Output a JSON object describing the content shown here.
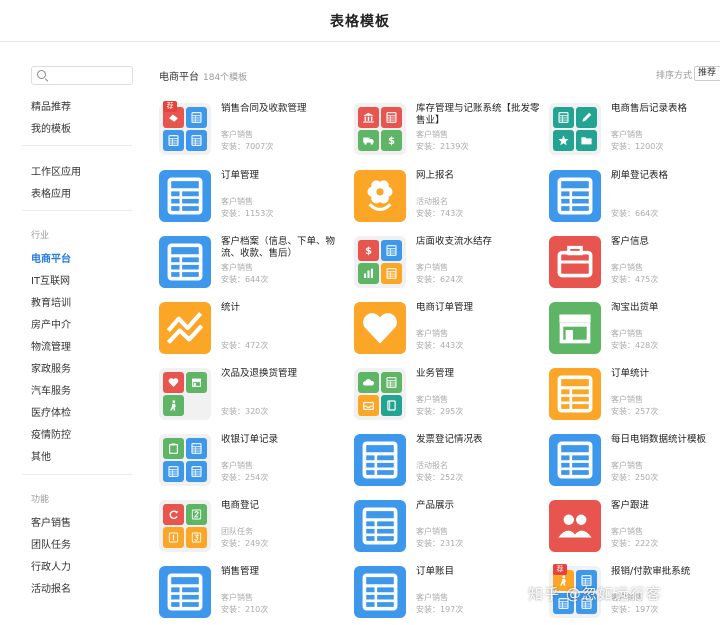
{
  "header": {
    "title": "表格模板"
  },
  "sidebar": {
    "search_placeholder": "",
    "top": [
      "精品推荐",
      "我的模板"
    ],
    "apps": [
      "工作区应用",
      "表格应用"
    ],
    "industry_heading": "行业",
    "industries": [
      "电商平台",
      "IT互联网",
      "教育培训",
      "房产中介",
      "物流管理",
      "家政服务",
      "汽车服务",
      "医疗体检",
      "疫情防控",
      "其他"
    ],
    "function_heading": "功能",
    "functions": [
      "客户销售",
      "团队任务",
      "行政人力",
      "活动报名"
    ]
  },
  "main": {
    "category": "电商平台",
    "count": "184个模板",
    "sort_label": "排序方式",
    "sort_value": "推荐"
  },
  "colors": {
    "accent": "#2a7de1",
    "blue": "#3d97ea",
    "orange": "#fba627",
    "red": "#e8554f",
    "green": "#5db565",
    "teal": "#23a392",
    "grid_bg": "#f1f1f1"
  },
  "cards": [
    {
      "name": "销售合同及收款管理",
      "category": "客户销售",
      "installs": "安装：7007次",
      "badge": "荐",
      "icon": "grid",
      "tiles": [
        [
          "#e8554f",
          "handshake-icon"
        ],
        [
          "#3d97ea",
          "table-icon"
        ],
        [
          "#3d97ea",
          "table-icon"
        ],
        [
          "#3d97ea",
          "table-icon"
        ]
      ]
    },
    {
      "name": "库存管理与记账系统【批发零售业】",
      "category": "客户销售",
      "installs": "安装：2139次",
      "icon": "grid",
      "tiles": [
        [
          "#e8554f",
          "bank-icon"
        ],
        [
          "#e8554f",
          "table-icon"
        ],
        [
          "#5db565",
          "truck-icon"
        ],
        [
          "#5db565",
          "dollar-icon"
        ]
      ]
    },
    {
      "name": "电商售后记录表格",
      "category": "客户销售",
      "installs": "安装：1200次",
      "icon": "grid",
      "tiles": [
        [
          "#23a392",
          "table-icon"
        ],
        [
          "#23a392",
          "pencil-icon"
        ],
        [
          "#23a392",
          "star-icon"
        ],
        [
          "#23a392",
          "folder-icon"
        ]
      ]
    },
    {
      "name": "订单管理",
      "category": "客户销售",
      "installs": "安装：1153次",
      "icon": "solid",
      "color": "#3d97ea",
      "glyph": "table-icon"
    },
    {
      "name": "网上报名",
      "category": "活动报名",
      "installs": "安装：743次",
      "icon": "solid",
      "color": "#fba627",
      "glyph": "flower-icon"
    },
    {
      "name": "刷单登记表格",
      "category": "",
      "installs": "安装：664次",
      "icon": "solid",
      "color": "#3d97ea",
      "glyph": "table-icon"
    },
    {
      "name": "客户档案（信息、下单、物流、收款、售后）",
      "category": "客户销售",
      "installs": "安装：644次",
      "icon": "solid",
      "color": "#3d97ea",
      "glyph": "table-icon"
    },
    {
      "name": "店面收支流水结存",
      "category": "客户销售",
      "installs": "安装：624次",
      "icon": "grid",
      "tiles": [
        [
          "#e8554f",
          "dollar-icon"
        ],
        [
          "#3d97ea",
          "table-icon"
        ],
        [
          "#5db565",
          "bar-chart-icon"
        ],
        [
          "#fba627",
          "table-icon"
        ]
      ]
    },
    {
      "name": "客户信息",
      "category": "客户销售",
      "installs": "安装：475次",
      "icon": "solid",
      "color": "#e8554f",
      "glyph": "briefcase-icon"
    },
    {
      "name": "统计",
      "category": "",
      "installs": "安装：472次",
      "icon": "solid",
      "color": "#fba627",
      "glyph": "trend-line-icon"
    },
    {
      "name": "电商订单管理",
      "category": "客户销售",
      "installs": "安装：443次",
      "icon": "solid",
      "color": "#fba627",
      "glyph": "heart-icon"
    },
    {
      "name": "淘宝出货单",
      "category": "客户销售",
      "installs": "安装：428次",
      "icon": "solid",
      "color": "#5db565",
      "glyph": "store-icon"
    },
    {
      "name": "次品及退换货管理",
      "category": "",
      "installs": "安装：320次",
      "icon": "grid",
      "tiles": [
        [
          "#e8554f",
          "heart-icon"
        ],
        [
          "#5db565",
          "store-icon"
        ],
        [
          "#5db565",
          "person-icon"
        ],
        null
      ]
    },
    {
      "name": "业务管理",
      "category": "客户销售",
      "installs": "安装：295次",
      "icon": "grid",
      "tiles": [
        [
          "#5db565",
          "cloud-icon"
        ],
        [
          "#5db565",
          "table-icon"
        ],
        [
          "#fba627",
          "inbox-icon"
        ],
        [
          "#23a392",
          "book-icon"
        ]
      ]
    },
    {
      "name": "订单统计",
      "category": "客户销售",
      "installs": "安装：257次",
      "icon": "solid",
      "color": "#fba627",
      "glyph": "table-icon"
    },
    {
      "name": "收银订单记录",
      "category": "客户销售",
      "installs": "安装：254次",
      "icon": "grid",
      "tiles": [
        [
          "#5db565",
          "clipboard-icon"
        ],
        [
          "#3d97ea",
          "table-icon"
        ],
        [
          "#3d97ea",
          "table-icon"
        ],
        [
          "#3d97ea",
          "table-icon"
        ]
      ]
    },
    {
      "name": "发票登记情况表",
      "category": "活动报名",
      "installs": "安装：252次",
      "icon": "solid",
      "color": "#3d97ea",
      "glyph": "table-icon"
    },
    {
      "name": "每日电销数据统计模板",
      "category": "客户销售",
      "installs": "安装：250次",
      "icon": "solid",
      "color": "#3d97ea",
      "glyph": "table-icon"
    },
    {
      "name": "电商登记",
      "category": "团队任务",
      "installs": "安装：249次",
      "icon": "grid",
      "tiles": [
        [
          "#e8554f",
          "refresh-icon"
        ],
        [
          "#5db565",
          "number-2-icon"
        ],
        [
          "#fba627",
          "number-1-icon"
        ],
        [
          "#fba627",
          "number-3-icon"
        ]
      ]
    },
    {
      "name": "产品展示",
      "category": "客户销售",
      "installs": "安装：231次",
      "icon": "solid",
      "color": "#3d97ea",
      "glyph": "table-icon"
    },
    {
      "name": "客户跟进",
      "category": "客户销售",
      "installs": "安装：222次",
      "icon": "solid",
      "color": "#e8554f",
      "glyph": "users-icon"
    },
    {
      "name": "销售管理",
      "category": "客户销售",
      "installs": "安装：210次",
      "icon": "solid",
      "color": "#3d97ea",
      "glyph": "table-icon"
    },
    {
      "name": "订单账目",
      "category": "客户销售",
      "installs": "安装：197次",
      "icon": "solid",
      "color": "#3d97ea",
      "glyph": "table-icon"
    },
    {
      "name": "报销/付款审批系统",
      "category": "客户销售",
      "installs": "安装：197次",
      "badge": "荐",
      "icon": "grid",
      "tiles": [
        [
          "#fba627",
          "person-icon"
        ],
        [
          "#3d97ea",
          "table-icon"
        ],
        [
          "#3d97ea",
          "table-icon"
        ],
        [
          "#3d97ea",
          "table-icon"
        ]
      ]
    }
  ],
  "watermark": "知乎 @忽如远行客"
}
